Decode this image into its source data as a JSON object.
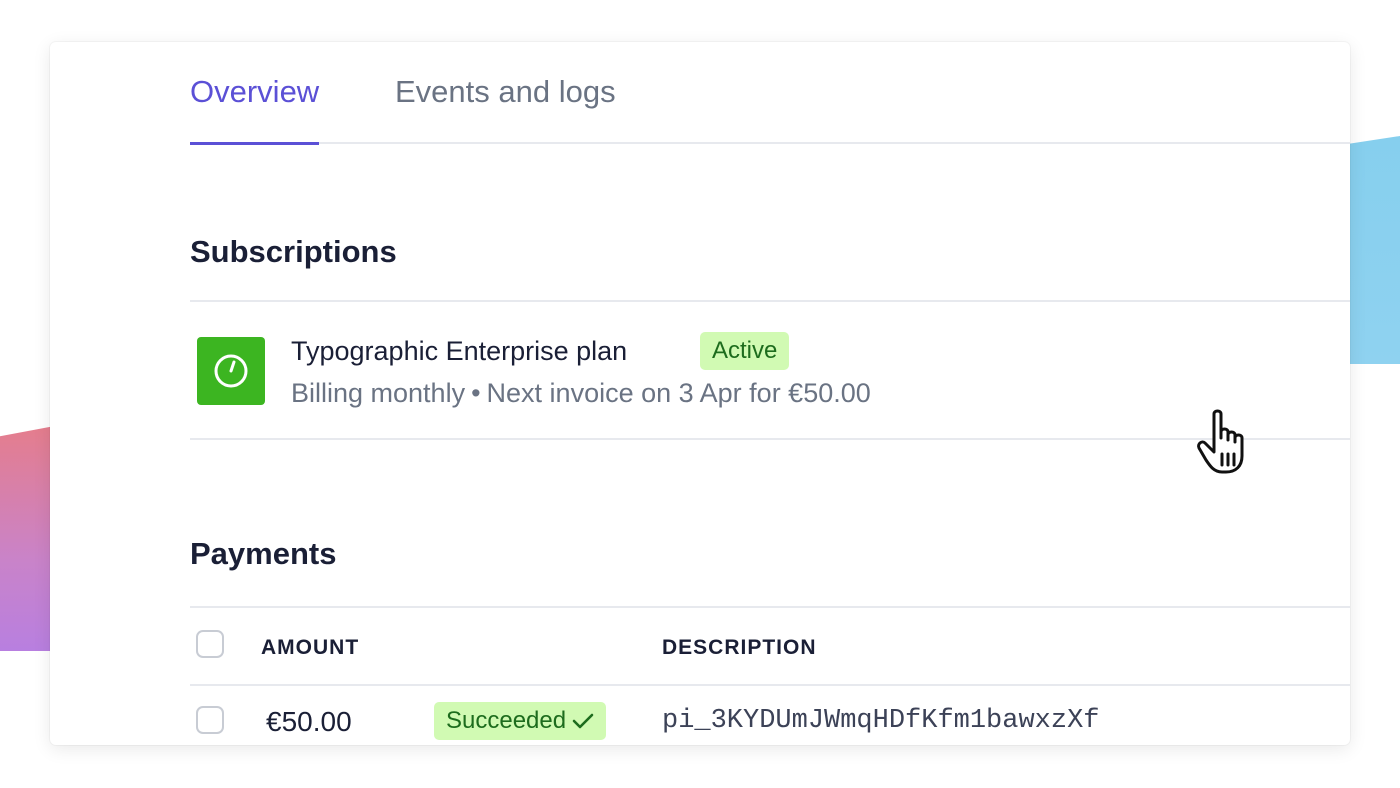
{
  "tabs": [
    {
      "label": "Overview",
      "active": true
    },
    {
      "label": "Events and logs",
      "active": false
    }
  ],
  "subscriptions": {
    "title": "Subscriptions",
    "items": [
      {
        "icon": "clock-icon",
        "plan_name": "Typographic Enterprise plan",
        "status": "Active",
        "billing": "Billing monthly",
        "separator": "•",
        "next_invoice": "Next invoice on 3 Apr for €50.00"
      }
    ]
  },
  "payments": {
    "title": "Payments",
    "columns": [
      "AMOUNT",
      "DESCRIPTION"
    ],
    "rows": [
      {
        "amount": "€50.00",
        "status": "Succeeded",
        "description": "pi_3KYDUmJWmqHDfKfm1bawxzXf"
      }
    ]
  },
  "colors": {
    "accent": "#5b50d6",
    "success_bg": "#d1fab3",
    "success_text": "#1d6c1d",
    "plan_icon_bg": "#3cb521"
  }
}
